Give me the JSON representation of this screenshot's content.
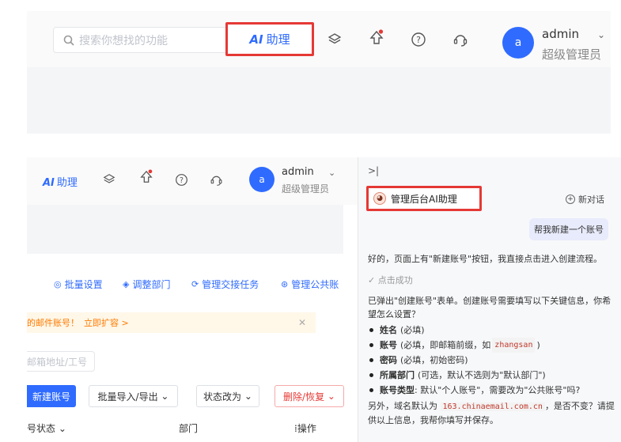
{
  "top": {
    "search_placeholder": "搜索你想找的功能",
    "ai_label": "助理",
    "ai_prefix": "AI",
    "avatar_letter": "a",
    "username": "admin",
    "role": "超级管理员"
  },
  "bottom_left": {
    "ai_prefix": "AI",
    "ai_label": "助理",
    "avatar_letter": "a",
    "username": "admin",
    "role": "超级管理员",
    "toolbar": {
      "batch_settings": "批量设置",
      "adjust_dept": "调整部门",
      "handover_tasks": "管理交接任务",
      "public_accounts": "管理公共账"
    },
    "banner_text": "的邮件账号！",
    "banner_link": "立即扩容 >",
    "filter_placeholder": "邮箱地址/工号",
    "buttons": {
      "new_account": "新建账号",
      "import_export": "批量导入/导出",
      "change_status": "状态改为",
      "delete_restore": "删除/恢复"
    },
    "table_headers": {
      "status": "号状态",
      "dept": "部门",
      "ops": "操作"
    }
  },
  "assistant": {
    "collapse_icon": ">|",
    "title": "管理后台AI助理",
    "new_chat": "新对话",
    "user_message": "帮我新建一个账号",
    "reply1": "好的，页面上有\"新建账号\"按钮，我直接点击进入创建流程。",
    "success": "点击成功",
    "reply2": "已弹出\"创建账号\"表单。创建账号需要填写以下关键信息，你希望怎么设置？",
    "fields": [
      {
        "name": "姓名",
        "desc": "(必填)",
        "code": "",
        "tail": ""
      },
      {
        "name": "账号",
        "desc": "(必填，即邮箱前缀，如",
        "code": "zhangsan",
        "tail": ")"
      },
      {
        "name": "密码",
        "desc": "(必填，初始密码)",
        "code": "",
        "tail": ""
      },
      {
        "name": "所属部门",
        "desc": "(可选，默认不选则为\"默认部门\")",
        "code": "",
        "tail": ""
      },
      {
        "name": "账号类型",
        "desc": ": 默认\"个人账号\"，需要改为\"公共账号\"吗?",
        "code": "",
        "tail": ""
      }
    ],
    "reply3_pre": "另外，域名默认为",
    "reply3_domain": "163.chinaemail.com.cn",
    "reply3_post": "，是否不变？请提供以上信息，我帮你填写并保存。"
  }
}
